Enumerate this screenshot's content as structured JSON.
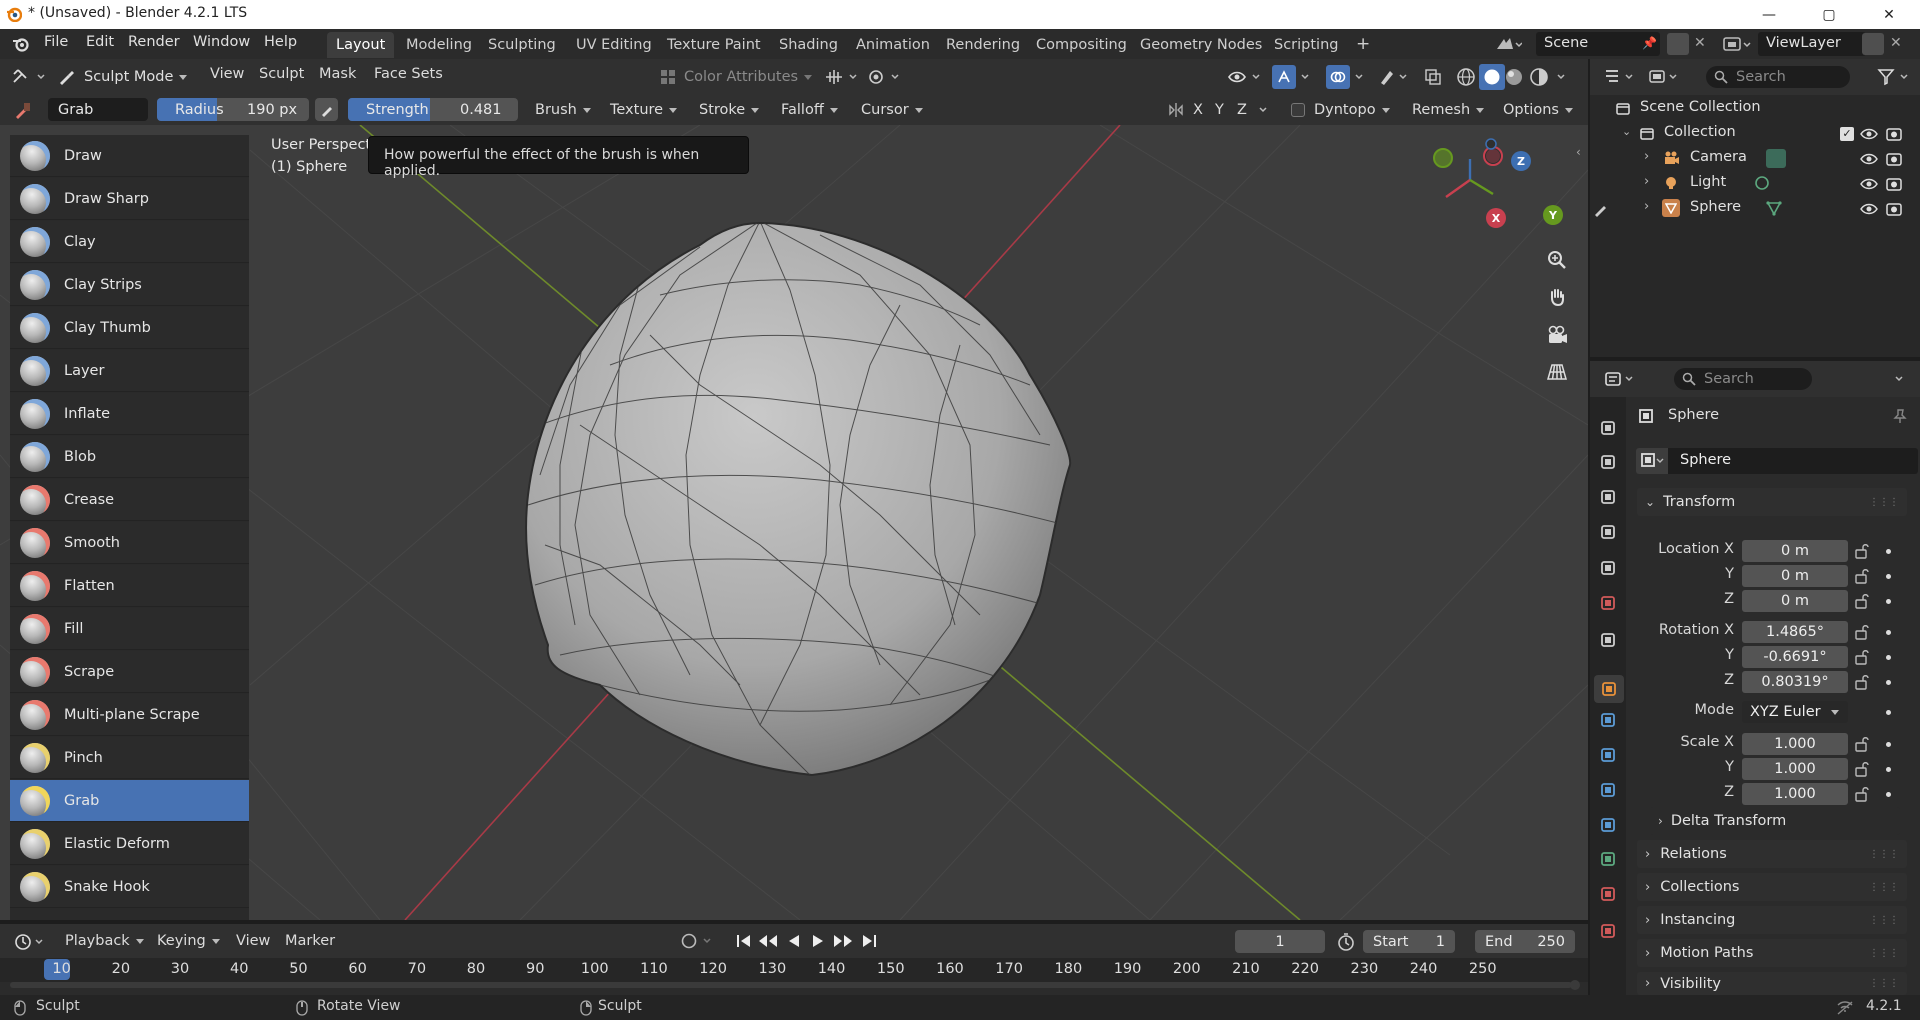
{
  "window": {
    "title": "* (Unsaved) - Blender 4.2.1 LTS",
    "minimize": "—",
    "maximize": "▢",
    "close": "✕"
  },
  "menubar": {
    "items": [
      "File",
      "Edit",
      "Render",
      "Window",
      "Help"
    ],
    "workspaces": [
      "Layout",
      "Modeling",
      "Sculpting",
      "UV Editing",
      "Texture Paint",
      "Shading",
      "Animation",
      "Rendering",
      "Compositing",
      "Geometry Nodes",
      "Scripting"
    ],
    "active_workspace": "Layout",
    "add_workspace": "+",
    "scene": "Scene",
    "view_layer": "ViewLayer"
  },
  "viewport_header": {
    "mode": "Sculpt Mode",
    "menus": [
      "View",
      "Sculpt",
      "Mask",
      "Face Sets"
    ],
    "color_attributes": "Color Attributes"
  },
  "tool_settings": {
    "brush_name": "Grab",
    "radius_label": "Radius",
    "radius_value": "190 px",
    "strength_label": "Strength",
    "strength_value": "0.481",
    "strength_fraction": 0.481,
    "dropdowns": [
      "Brush",
      "Texture",
      "Stroke",
      "Falloff",
      "Cursor"
    ],
    "axes": [
      "X",
      "Y",
      "Z"
    ],
    "dyntopo": "Dyntopo",
    "remesh": "Remesh",
    "options": "Options"
  },
  "viewport": {
    "view_name": "User Perspective",
    "object_label": "(1) Sphere",
    "tooltip": "How powerful the effect of the brush is when applied.",
    "gizmo": {
      "x": "X",
      "y": "Y",
      "z": "Z"
    }
  },
  "brushes": [
    {
      "label": "Draw",
      "color": "#7fa7d9"
    },
    {
      "label": "Draw Sharp",
      "color": "#7fa7d9"
    },
    {
      "label": "Clay",
      "color": "#7fa7d9"
    },
    {
      "label": "Clay Strips",
      "color": "#7fa7d9"
    },
    {
      "label": "Clay Thumb",
      "color": "#7fa7d9"
    },
    {
      "label": "Layer",
      "color": "#7fa7d9"
    },
    {
      "label": "Inflate",
      "color": "#7fa7d9"
    },
    {
      "label": "Blob",
      "color": "#7fa7d9"
    },
    {
      "label": "Crease",
      "color": "#e8796e"
    },
    {
      "label": "Smooth",
      "color": "#e8796e"
    },
    {
      "label": "Flatten",
      "color": "#e8796e"
    },
    {
      "label": "Fill",
      "color": "#e8796e"
    },
    {
      "label": "Scrape",
      "color": "#e8796e"
    },
    {
      "label": "Multi-plane Scrape",
      "color": "#e8796e"
    },
    {
      "label": "Pinch",
      "color": "#e8d06e"
    },
    {
      "label": "Grab",
      "color": "#f0d65a"
    },
    {
      "label": "Elastic Deform",
      "color": "#e8d06e"
    },
    {
      "label": "Snake Hook",
      "color": "#e8d06e"
    }
  ],
  "selected_brush": "Grab",
  "outliner": {
    "search_placeholder": "Search",
    "root": "Scene Collection",
    "collection": "Collection",
    "items": [
      "Camera",
      "Light",
      "Sphere"
    ]
  },
  "properties": {
    "search_placeholder": "Search",
    "object_name": "Sphere",
    "data_name": "Sphere",
    "transform_title": "Transform",
    "location_x_label": "Location X",
    "location": [
      "0 m",
      "0 m",
      "0 m"
    ],
    "rotation_x_label": "Rotation X",
    "rotation": [
      "1.4865°",
      "-0.6691°",
      "0.80319°"
    ],
    "mode_label": "Mode",
    "mode_value": "XYZ Euler",
    "scale_x_label": "Scale X",
    "scale": [
      "1.000",
      "1.000",
      "1.000"
    ],
    "y_label": "Y",
    "z_label": "Z",
    "delta_transform": "Delta Transform",
    "panels": [
      "Relations",
      "Collections",
      "Instancing",
      "Motion Paths",
      "Visibility"
    ]
  },
  "timeline": {
    "menus": [
      "Playback",
      "Keying",
      "View",
      "Marker"
    ],
    "current_frame": "1",
    "start_label": "Start",
    "start_value": "1",
    "end_label": "End",
    "end_value": "250",
    "ruler": [
      "1",
      "10",
      "20",
      "30",
      "40",
      "50",
      "60",
      "70",
      "80",
      "90",
      "100",
      "110",
      "120",
      "130",
      "140",
      "150",
      "160",
      "170",
      "180",
      "190",
      "200",
      "210",
      "220",
      "230",
      "240",
      "250"
    ]
  },
  "statusbar": {
    "left": "Sculpt",
    "middle": "Rotate View",
    "right": "Sculpt",
    "version": "4.2.1"
  }
}
